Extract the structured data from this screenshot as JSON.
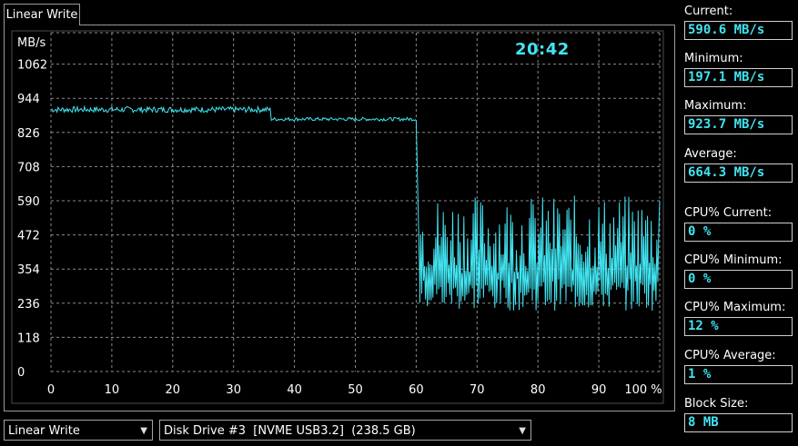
{
  "tab": {
    "label": "Linear Write"
  },
  "clock": "20:42",
  "stats": [
    {
      "label": "Current:",
      "value": "590.6 MB/s"
    },
    {
      "label": "Minimum:",
      "value": "197.1 MB/s"
    },
    {
      "label": "Maximum:",
      "value": "923.7 MB/s"
    },
    {
      "label": "Average:",
      "value": "664.3 MB/s"
    },
    {
      "label": "CPU% Current:",
      "value": "0 %"
    },
    {
      "label": "CPU% Minimum:",
      "value": "0 %"
    },
    {
      "label": "CPU% Maximum:",
      "value": "12 %"
    },
    {
      "label": "CPU% Average:",
      "value": "1 %"
    },
    {
      "label": "Block Size:",
      "value": "8 MB"
    }
  ],
  "controls": {
    "test_select": "Linear Write",
    "drive_select": "Disk Drive #3  [NVME USB3.2]  (238.5 GB)"
  },
  "colors": {
    "trace": "#41e5f2",
    "value_text": "#41e5f2",
    "grid": "#8a8a8a",
    "background": "#000000"
  },
  "chart_data": {
    "type": "line",
    "title": "",
    "ylabel": "MB/s",
    "xlabel": "",
    "y_ticks": [
      "0",
      "118",
      "236",
      "354",
      "472",
      "590",
      "708",
      "826",
      "944",
      "1062"
    ],
    "x_ticks": [
      "0",
      "10",
      "20",
      "30",
      "40",
      "50",
      "60",
      "70",
      "80",
      "90",
      "100 %"
    ],
    "xlim": [
      0,
      100
    ],
    "ylim": [
      0,
      1180
    ],
    "grid": true,
    "series": [
      {
        "segments": [
          {
            "type": "steady",
            "x": [
              0,
              36
            ],
            "mean": 905,
            "jitter": 10
          },
          {
            "type": "steady",
            "x": [
              36.2,
              60
            ],
            "mean": 872,
            "jitter": 6
          },
          {
            "type": "drop",
            "x": [
              60,
              60.6
            ],
            "y": [
              866,
              300
            ]
          },
          {
            "type": "oscillating",
            "x": [
              60.6,
              100
            ],
            "low": 210,
            "high": 610,
            "end": 590
          }
        ]
      }
    ]
  }
}
